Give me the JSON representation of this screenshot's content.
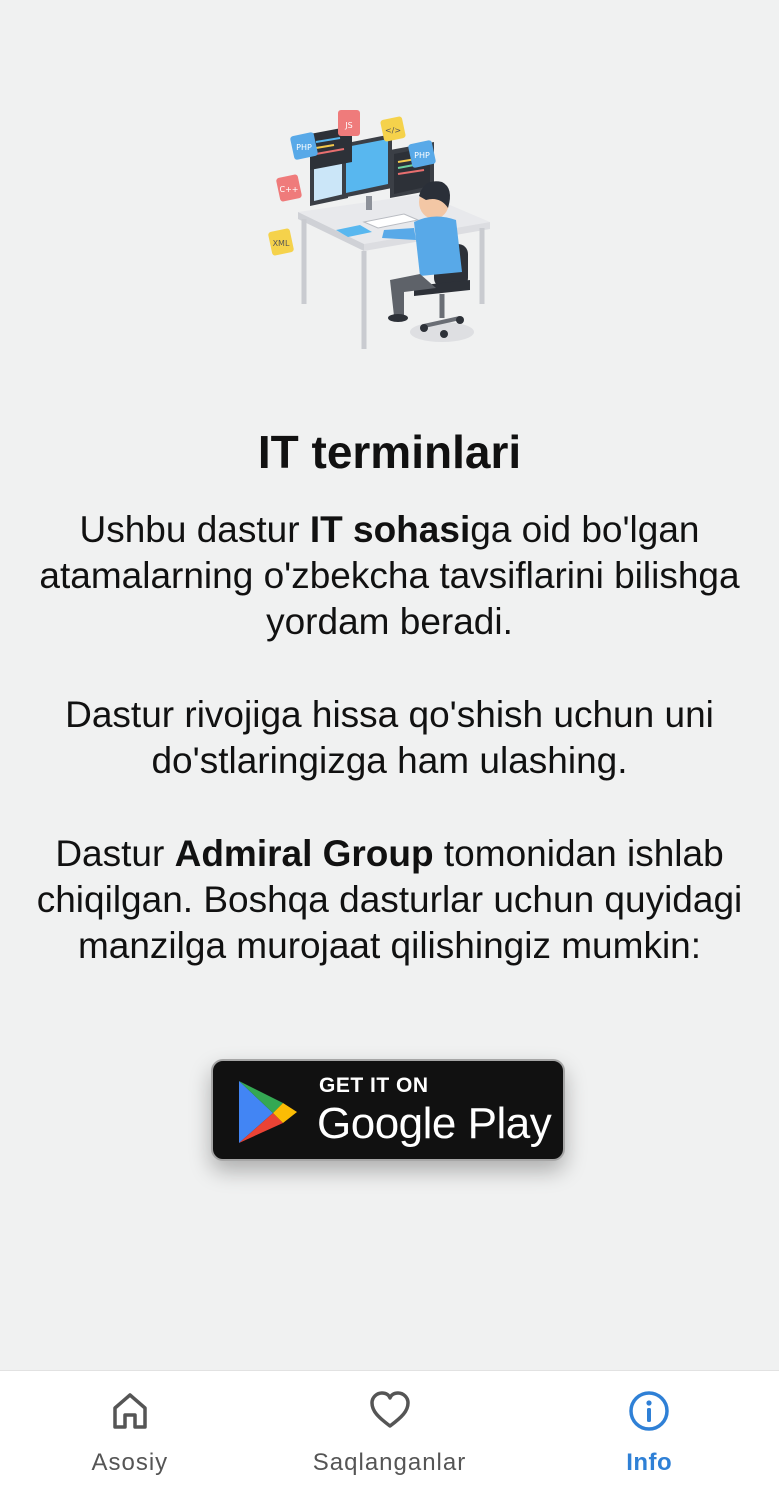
{
  "info": {
    "title": "IT terminlari",
    "para1": {
      "a": "Ushbu dastur ",
      "b": "IT sohasi",
      "c": "ga oid bo'lgan atamalarning o'zbekcha tavsiflarini bilishga yordam beradi."
    },
    "para2": "Dastur rivojiga hissa qo'shish uchun uni do'stlaringizga ham ulashing.",
    "para3": {
      "a": "Dastur ",
      "b": "Admiral Group",
      "c": " tomonidan ishlab chiqilgan. Boshqa dasturlar uchun quyidagi manzilga murojaat qilishingiz mumkin:"
    },
    "illustration_tags": [
      "PHP",
      "JS",
      "</>",
      "PHP",
      "C++",
      "XML"
    ]
  },
  "play_badge": {
    "small": "GET IT ON",
    "big": "Google Play"
  },
  "bottom_nav": {
    "items": [
      {
        "label": "Asosiy",
        "icon": "home-icon"
      },
      {
        "label": "Saqlanganlar",
        "icon": "heart-icon"
      },
      {
        "label": "Info",
        "icon": "info-icon"
      }
    ],
    "active_index": 2,
    "active_color": "#2f80d6",
    "inactive_color": "#555555"
  }
}
